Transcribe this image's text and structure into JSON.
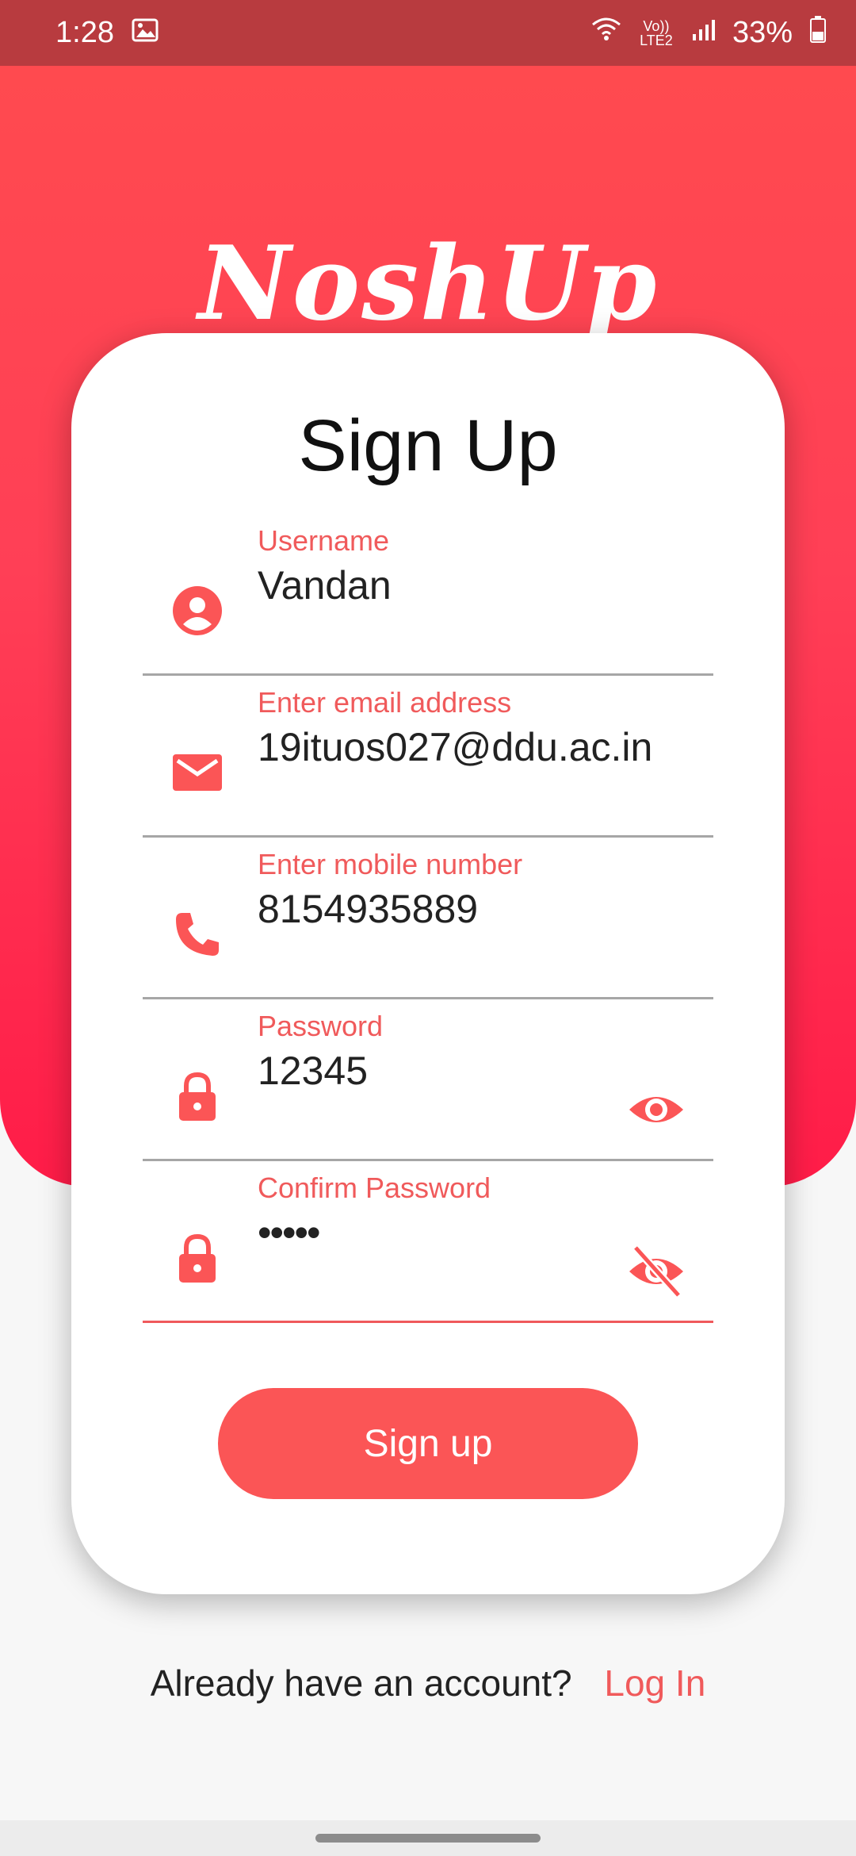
{
  "status": {
    "time": "1:28",
    "battery": "33%",
    "network": "Vo)) LTE2"
  },
  "brand": "NoshUp",
  "title": "Sign Up",
  "fields": [
    {
      "label": "Username",
      "value": "Vandan",
      "icon": "person-icon"
    },
    {
      "label": "Enter email address",
      "value": "19ituos027@ddu.ac.in",
      "icon": "mail-icon"
    },
    {
      "label": "Enter mobile number",
      "value": "8154935889",
      "icon": "phone-icon"
    },
    {
      "label": "Password",
      "value": "12345",
      "icon": "lock-icon",
      "toggle": "eye-icon"
    },
    {
      "label": "Confirm Password",
      "value": "•••••",
      "icon": "lock-icon",
      "toggle": "eye-off-icon"
    }
  ],
  "signup_button": "Sign up",
  "footer": {
    "prompt": "Already have an account?",
    "link": "Log In"
  },
  "colors": {
    "accent": "#fb5556",
    "hero_top": "#ff4a4f",
    "hero_bottom": "#ff1c48",
    "statusbar": "#b83b3f"
  }
}
